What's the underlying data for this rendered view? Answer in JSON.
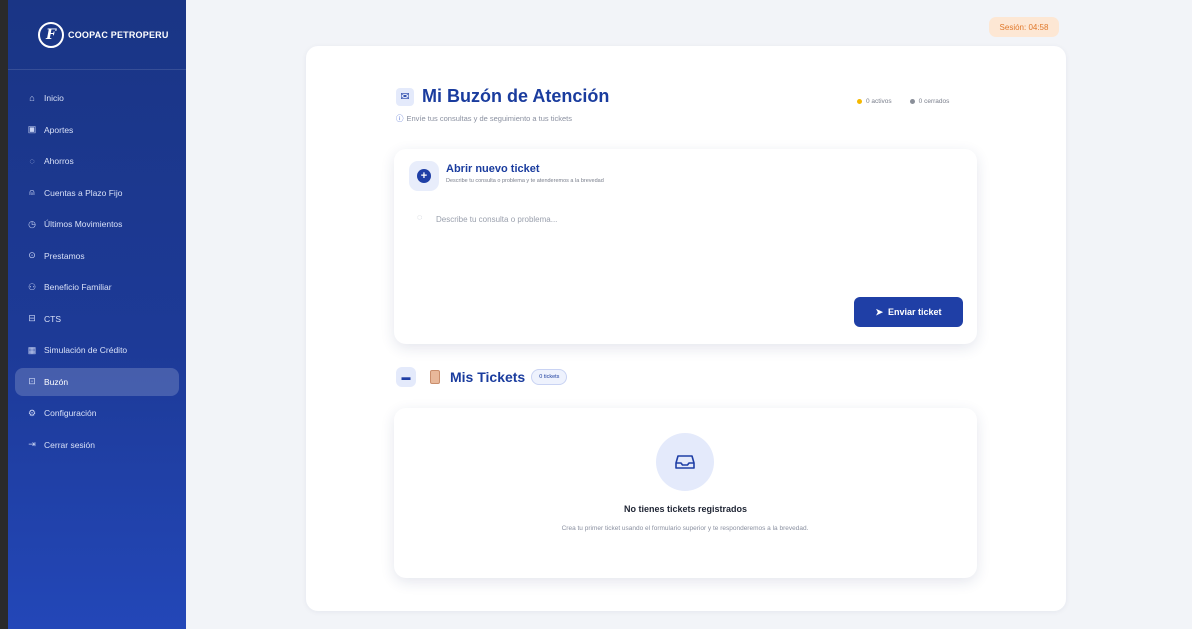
{
  "brand": {
    "logo_text": "COOPAC PETROPERU"
  },
  "sidebar": {
    "items": [
      {
        "label": "Inicio",
        "icon": "home-icon",
        "glyph": "⌂",
        "active": false
      },
      {
        "label": "Aportes",
        "icon": "money-icon",
        "glyph": "▣",
        "active": false
      },
      {
        "label": "Ahorros",
        "icon": "piggy-bank-icon",
        "glyph": "◌",
        "active": false
      },
      {
        "label": "Cuentas a Plazo Fijo",
        "icon": "lock-icon",
        "glyph": "⍝",
        "active": false
      },
      {
        "label": "Últimos Movimientos",
        "icon": "clock-icon",
        "glyph": "◷",
        "active": false
      },
      {
        "label": "Prestamos",
        "icon": "coin-icon",
        "glyph": "⊙",
        "active": false
      },
      {
        "label": "Beneficio Familiar",
        "icon": "family-icon",
        "glyph": "⚇",
        "active": false
      },
      {
        "label": "CTS",
        "icon": "briefcase-icon",
        "glyph": "⊟",
        "active": false
      },
      {
        "label": "Simulación de Crédito",
        "icon": "calculator-icon",
        "glyph": "▦",
        "active": false
      },
      {
        "label": "Buzón",
        "icon": "inbox-icon",
        "glyph": "⊡",
        "active": true
      },
      {
        "label": "Configuración",
        "icon": "gear-icon",
        "glyph": "⚙",
        "active": false
      },
      {
        "label": "Cerrar sesión",
        "icon": "logout-icon",
        "glyph": "⇥",
        "active": false
      }
    ]
  },
  "session": {
    "label": "Sesión: 04:58"
  },
  "header": {
    "title": "Mi Buzón de Atención",
    "subtitle": "Envíe tus consultas y de seguimiento a tus tickets",
    "stats": {
      "active": "0 activos",
      "closed": "0 cerrados"
    }
  },
  "new_ticket": {
    "title": "Abrir nuevo ticket",
    "subtitle": "Describe tu consulta o problema y te atenderemos a la brevedad",
    "placeholder": "Describe tu consulta o problema...",
    "submit_label": "Enviar ticket"
  },
  "tickets": {
    "title": "Mis Tickets",
    "count_badge": "0 tickets",
    "empty_title": "No tienes tickets registrados",
    "empty_desc": "Crea tu primer ticket usando el formulario superior y te responderemos a la brevedad."
  },
  "colors": {
    "primary": "#1f3fa6",
    "sidebar_top": "#1a3585",
    "sidebar_bottom": "#2347b8",
    "session_bg": "#fde7d4",
    "session_text": "#e0782a",
    "active_dot": "#f5b800",
    "closed_dot": "#8a8f99"
  }
}
